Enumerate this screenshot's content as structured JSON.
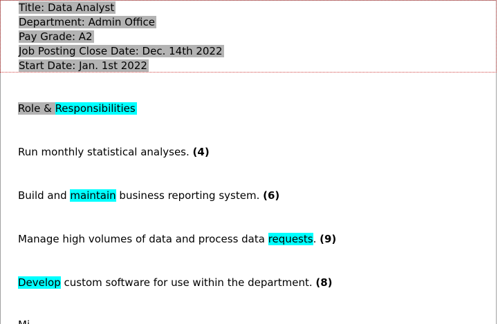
{
  "header": {
    "title": "Title: Data Analyst",
    "department": "Department: Admin Office",
    "pay_grade": "Pay Grade: A2",
    "close_date": "Job Posting Close Date: Dec. 14th 2022",
    "start_date": "Start Date: Jan. 1st 2022"
  },
  "section_heading": {
    "prefix": "Role & ",
    "highlighted": "Responsibilities"
  },
  "items": [
    {
      "before": "Run monthly statistical analyses. ",
      "highlight": "",
      "after": "",
      "count": "(4)"
    },
    {
      "before": "Build and ",
      "highlight": "maintain",
      "after": " business reporting system. ",
      "count": "(6)"
    },
    {
      "before": "Manage high volumes of data and process data ",
      "highlight": "requests",
      "after": ". ",
      "count": "(9)"
    },
    {
      "before": "",
      "highlight": "Develop",
      "after": " custom software for use within the department. ",
      "count": "(8)"
    },
    {
      "before": "Mi ",
      "highlight": "",
      "after": "",
      "count": ""
    }
  ],
  "colors": {
    "grey_highlight": "#b3b3b3",
    "cyan_highlight": "#00ffff",
    "header_border": "#d04040"
  }
}
